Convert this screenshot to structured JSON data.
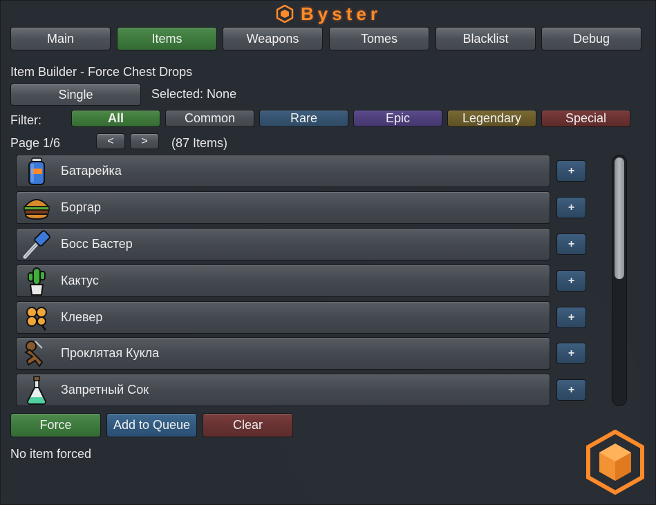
{
  "app": {
    "title": "Byster"
  },
  "tabs": [
    {
      "label": "Main"
    },
    {
      "label": "Items"
    },
    {
      "label": "Weapons"
    },
    {
      "label": "Tomes"
    },
    {
      "label": "Blacklist"
    },
    {
      "label": "Debug"
    }
  ],
  "builder": {
    "heading": "Item Builder - Force Chest Drops",
    "mode_button": "Single",
    "selected_text": "Selected: None",
    "filter_label": "Filter:",
    "filters": [
      "All",
      "Common",
      "Rare",
      "Epic",
      "Legendary",
      "Special"
    ],
    "page_text": "Page 1/6",
    "prev_label": "<",
    "next_label": ">",
    "count_text": "(87 Items)"
  },
  "items": [
    {
      "name": "Батарейка",
      "icon": "battery-icon"
    },
    {
      "name": "Боргар",
      "icon": "burger-icon"
    },
    {
      "name": "Босс Бастер",
      "icon": "hammer-icon"
    },
    {
      "name": "Кактус",
      "icon": "cactus-icon"
    },
    {
      "name": "Клевер",
      "icon": "clover-icon"
    },
    {
      "name": "Проклятая Кукла",
      "icon": "voodoo-doll-icon"
    },
    {
      "name": "Запретный Сок",
      "icon": "potion-icon"
    }
  ],
  "add_label": "+",
  "actions": {
    "force": "Force",
    "queue": "Add to Queue",
    "clear": "Clear"
  },
  "status": "No item forced",
  "colors": {
    "accent": "#ff8a2a",
    "active_green": "#3d7a3c",
    "rare": "#35536f",
    "epic": "#4e3f7b",
    "legendary": "#6b5c2b",
    "special": "#6b3232"
  }
}
